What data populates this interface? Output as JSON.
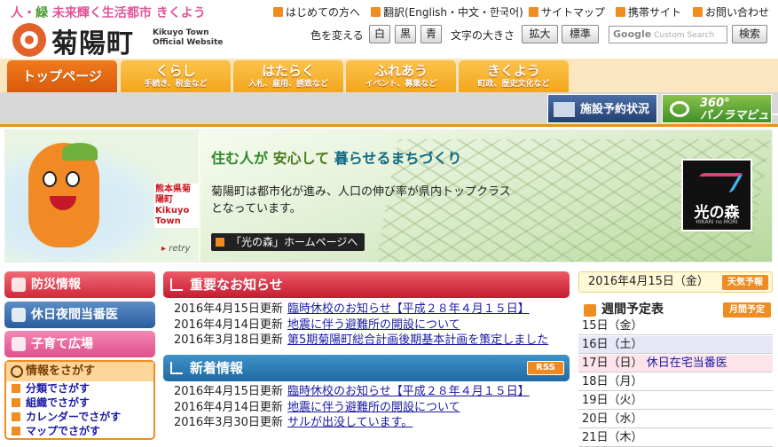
{
  "header": {
    "tagline_pre": "人・",
    "tagline_green": "緑",
    "tagline_post": "未来輝く生活都市 きくよう",
    "town_name": "菊陽町",
    "town_name_en_1": "Kikuyo Town",
    "town_name_en_2": "Official Website",
    "util_links": [
      "はじめての方へ",
      "翻訳(English・中文・한국어)",
      "サイトマップ",
      "携帯サイト",
      "お問い合わせ"
    ],
    "color_label": "色を変える",
    "color_options": [
      "白",
      "黒",
      "青"
    ],
    "size_label": "文字の大きさ",
    "size_options": [
      "拡大",
      "標準"
    ],
    "search_placeholder_brand": "Google",
    "search_placeholder": "Custom Search",
    "search_button": "検索"
  },
  "nav": {
    "tabs": [
      {
        "main": "トップページ",
        "sub": ""
      },
      {
        "main": "くらし",
        "sub": "手続き、税金など"
      },
      {
        "main": "はたらく",
        "sub": "入札、雇用、誘致など"
      },
      {
        "main": "ふれあう",
        "sub": "イベント、募集など"
      },
      {
        "main": "きくよう",
        "sub": "町政、歴史文化など"
      }
    ],
    "facility_button": "施設予約状況",
    "panorama_button_1": "360°",
    "panorama_button_2": "パノラマビュー"
  },
  "hero": {
    "map_label_1": "熊本県菊陽町",
    "map_label_2": "Kikuyo Town",
    "retry": "retry",
    "headline_1": "住む人が",
    "headline_2": "安心して",
    "headline_3": "暮らせるまちづくり",
    "body": "菊陽町は都市化が進み、人口の伸び率が県内トップクラスとなっています。",
    "link_button": "「光の森」ホームページへ",
    "logo_text": "光の森",
    "logo_sub": "HIKARI no MORI"
  },
  "left": {
    "buttons": [
      "防災情報",
      "休日夜間当番医",
      "子育て広場"
    ],
    "find_title": "情報をさがす",
    "find_items": [
      "分類でさがす",
      "組織でさがす",
      "カレンダーでさがす",
      "マップでさがす"
    ]
  },
  "important": {
    "title": "重要なお知らせ",
    "items": [
      {
        "date": "2016年4月15日更新",
        "text": "臨時休校のお知らせ【平成２８年４月１５日】"
      },
      {
        "date": "2016年4月14日更新",
        "text": "地震に伴う避難所の開設について"
      },
      {
        "date": "2016年3月18日更新",
        "text": "第5期菊陽町総合計画後期基本計画を策定しました"
      }
    ]
  },
  "news": {
    "title": "新着情報",
    "rss": "RSS",
    "items": [
      {
        "date": "2016年4月15日更新",
        "text": "臨時休校のお知らせ【平成２８年４月１５日】"
      },
      {
        "date": "2016年4月14日更新",
        "text": "地震に伴う避難所の開設について"
      },
      {
        "date": "2016年3月30日更新",
        "text": "サルが出没しています。"
      }
    ]
  },
  "right": {
    "today": "2016年4月15日（金）",
    "weather_button": "天気予報",
    "weekly_title": "週間予定表",
    "monthly_button": "月間予定",
    "days": [
      {
        "day": "15日（金）",
        "event": ""
      },
      {
        "day": "16日（土）",
        "event": ""
      },
      {
        "day": "17日（日）",
        "event": "休日在宅当番医"
      },
      {
        "day": "18日（月）",
        "event": ""
      },
      {
        "day": "19日（火）",
        "event": ""
      },
      {
        "day": "20日（水）",
        "event": ""
      },
      {
        "day": "21日（木）",
        "event": ""
      }
    ]
  }
}
